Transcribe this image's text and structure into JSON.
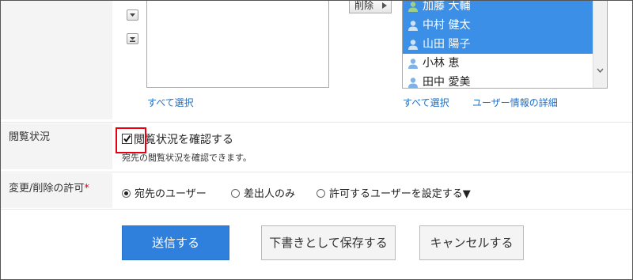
{
  "recipient_picker": {
    "remove_button_label": "削除",
    "selected_users": [
      {
        "name": "加藤 大輔",
        "selected": true
      },
      {
        "name": "中村 健太",
        "selected": true
      },
      {
        "name": "山田 陽子",
        "selected": true
      },
      {
        "name": "小林 恵",
        "selected": false
      },
      {
        "name": "田中 愛美",
        "selected": false
      }
    ],
    "left_select_all": "すべて選択",
    "right_select_all": "すべて選択",
    "user_details_link": "ユーザー情報の詳細",
    "icons": [
      "move-down-icon",
      "move-bottom-icon",
      "user-icon",
      "scroll-down-icon",
      "triangle-right-icon"
    ]
  },
  "read_status": {
    "label": "閲覧状況",
    "checkbox_label": "閲覧状況を確認する",
    "checked": true,
    "note": "宛先の閲覧状況を確認できます。"
  },
  "edit_permission": {
    "label": "変更/削除の許可",
    "required_mark": "*",
    "options": [
      {
        "label": "宛先のユーザー",
        "checked": true
      },
      {
        "label": "差出人のみ",
        "checked": false
      },
      {
        "label": "許可するユーザーを設定する▼",
        "checked": false
      }
    ]
  },
  "actions": {
    "send": "送信する",
    "save_draft": "下書きとして保存する",
    "cancel": "キャンセルする"
  },
  "colors": {
    "primary": "#2f7fdd",
    "selection": "#3b8fe6",
    "link": "#1e6fc8",
    "required": "#e60012",
    "highlight_border": "#e60012"
  }
}
